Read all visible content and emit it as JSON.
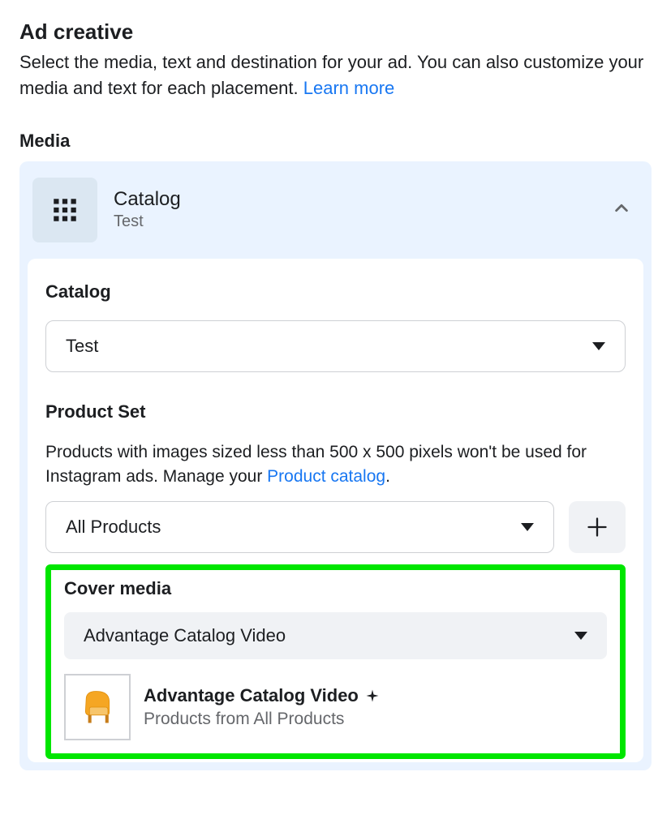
{
  "header": {
    "title": "Ad creative",
    "description_prefix": "Select the media, text and destination for your ad. You can also customize your media and text for each placement. ",
    "learn_more": "Learn more"
  },
  "media": {
    "label": "Media",
    "catalog_option": {
      "title": "Catalog",
      "subtitle": "Test"
    }
  },
  "catalog": {
    "label": "Catalog",
    "selected": "Test"
  },
  "product_set": {
    "label": "Product Set",
    "help_prefix": "Products with images sized less than 500 x 500 pixels won't be used for Instagram ads. Manage your ",
    "help_link": "Product catalog",
    "help_suffix": ".",
    "selected": "All Products"
  },
  "cover_media": {
    "label": "Cover media",
    "selected": "Advantage Catalog Video",
    "preview_title": "Advantage Catalog Video",
    "preview_subtitle": "Products from All Products"
  }
}
